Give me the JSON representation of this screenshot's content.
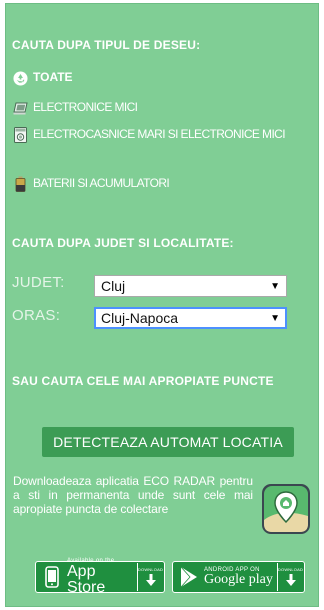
{
  "categories_section": {
    "heading": "CAUTA DUPA TIPUL DE DESEU:",
    "items": [
      {
        "label": "TOATE",
        "icon": "recycle-icon",
        "active": true
      },
      {
        "label": "ELECTRONICE MICI",
        "icon": "electronics-icon",
        "active": false
      },
      {
        "label": "ELECTROCASNICE MARI SI ELECTRONICE MICI",
        "icon": "appliance-icon",
        "active": false
      },
      {
        "label": "BATERII SI ACUMULATORI",
        "icon": "battery-icon",
        "active": false
      }
    ]
  },
  "location_section": {
    "heading": "CAUTA DUPA JUDET SI LOCALITATE:",
    "county_label": "JUDET:",
    "county_value": "Cluj",
    "city_label": "ORAS:",
    "city_value": "Cluj-Napoca"
  },
  "nearby_section": {
    "heading": "SAU CAUTA CELE MAI APROPIATE PUNCTE",
    "detect_button": "DETECTEAZA AUTOMAT LOCATIA"
  },
  "promo": {
    "text": "Downloadeaza aplicatia ECO RADAR pentru a sti in permanenta unde sunt cele mai apropiate puncta de colectare"
  },
  "stores": {
    "appstore_small": "Available on the",
    "appstore_big": "App Store",
    "googleplay_small": "ANDROID APP ON",
    "googleplay_big": "Google play",
    "download_label": "DOWNLOAD"
  },
  "colors": {
    "panel": "#80ce95",
    "button": "#3c9c55",
    "store_badge": "#1f8f3f"
  }
}
